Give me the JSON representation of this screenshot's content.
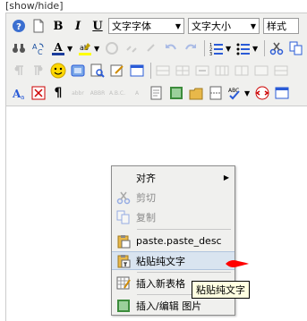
{
  "showhide": "[show/hide]",
  "toolbar": {
    "font_family": "文字字体",
    "font_size": "文字大小",
    "style": "样式"
  },
  "menu": {
    "items": [
      {
        "label": "对齐",
        "icon": "none",
        "submenu": true
      },
      {
        "label": "剪切",
        "icon": "cut-icon",
        "disabled": true
      },
      {
        "label": "复制",
        "icon": "copy-icon",
        "disabled": true
      },
      {
        "label": "paste.paste_desc",
        "icon": "paste-icon"
      },
      {
        "label": "粘贴纯文字",
        "icon": "paste-text-icon",
        "highlighted": true
      },
      {
        "label": "插入新表格",
        "icon": "table-icon"
      },
      {
        "label": "插入/编辑 图片",
        "icon": "image-icon"
      }
    ]
  },
  "tooltip": "粘贴纯文字",
  "colors": {
    "toolbar_bg": "#f0f0ee",
    "highlight": "#d9e4f0",
    "annotation": "#ff0000",
    "tooltip_bg": "#ffffe1"
  }
}
